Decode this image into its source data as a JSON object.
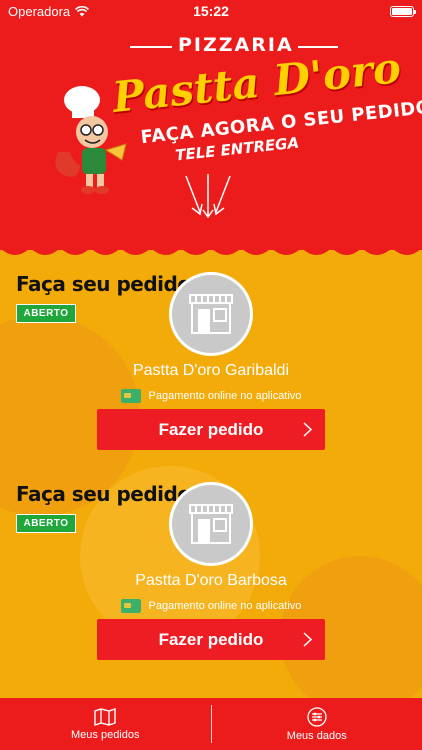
{
  "status_bar": {
    "carrier": "Operadora",
    "time": "15:22"
  },
  "brand": {
    "pizzaria": "PIZZARIA",
    "name": "Pastta D'oro",
    "tagline": "FAÇA AGORA O SEU PEDIDO",
    "delivery": "TELE ENTREGA"
  },
  "stores": [
    {
      "heading": "Faça seu pedido",
      "status": "ABERTO",
      "name": "Pastta D'oro Garibaldi",
      "payment": "Pagamento online no aplicativo",
      "button": "Fazer pedido"
    },
    {
      "heading": "Faça seu pedido",
      "status": "ABERTO",
      "name": "Pastta D'oro Barbosa",
      "payment": "Pagamento online no aplicativo",
      "button": "Fazer pedido"
    }
  ],
  "tabbar": {
    "orders": "Meus pedidos",
    "profile": "Meus dados"
  },
  "colors": {
    "primary": "#ed1c1c",
    "background": "#f3ab0a",
    "open": "#1fa73b",
    "brand_gold": "#ffd000"
  }
}
